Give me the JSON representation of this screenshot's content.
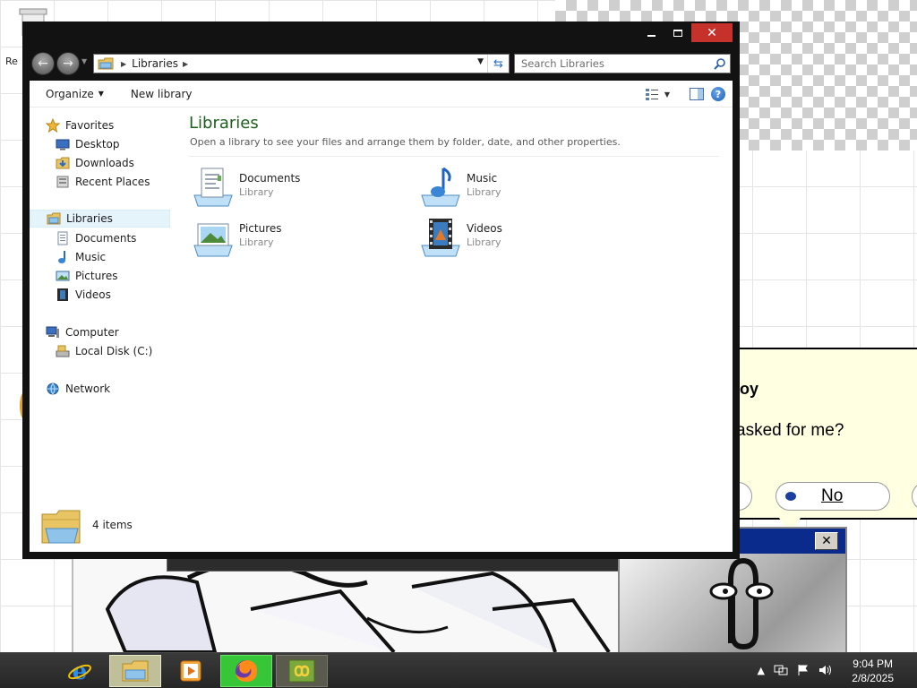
{
  "explorer": {
    "breadcrumb": "Libraries",
    "search_placeholder": "Search Libraries",
    "toolbar": {
      "organize": "Organize",
      "new_library": "New library"
    },
    "nav": {
      "favorites": "Favorites",
      "favorite_items": [
        "Desktop",
        "Downloads",
        "Recent Places"
      ],
      "libraries": "Libraries",
      "library_items": [
        "Documents",
        "Music",
        "Pictures",
        "Videos"
      ],
      "computer": "Computer",
      "computer_items": [
        "Local Disk (C:)"
      ],
      "network": "Network"
    },
    "main": {
      "title": "Libraries",
      "subtitle": "Open a library to see your files and arrange them by folder, date, and other properties.",
      "items": [
        {
          "name": "Documents",
          "type": "Library",
          "icon": "documents-library-icon"
        },
        {
          "name": "Music",
          "type": "Library",
          "icon": "music-library-icon"
        },
        {
          "name": "Pictures",
          "type": "Library",
          "icon": "pictures-library-icon"
        },
        {
          "name": "Videos",
          "type": "Library",
          "icon": "videos-library-icon"
        }
      ]
    },
    "status": {
      "count": "4 items"
    }
  },
  "desktop": {
    "icon_label_partial": "Re",
    "clippy": {
      "title_partial": "oy",
      "question_partial": "asked for me?",
      "no_button": "No"
    }
  },
  "taskbar": {
    "apps": [
      "internet-explorer",
      "file-explorer",
      "media-player",
      "firefox",
      "green-app"
    ],
    "clock_time": "9:04 PM",
    "clock_date": "2/8/2025"
  },
  "colors": {
    "window_frame": "#121212",
    "close_button": "#c7312c",
    "title_green": "#1e5f1e",
    "taskbar": "#2e2e2e",
    "clippy_bubble": "#ffffe1"
  }
}
